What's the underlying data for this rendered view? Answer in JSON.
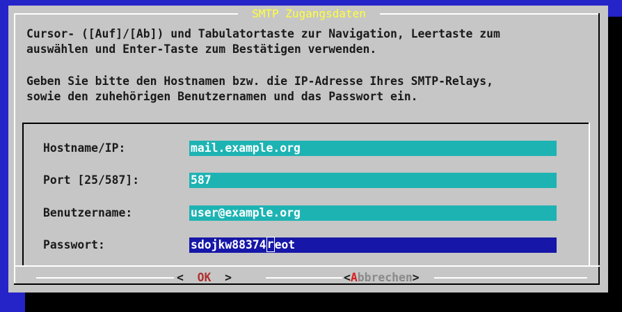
{
  "dialog": {
    "title": "SMTP Zugangsdaten",
    "instructions": [
      "Cursor- ([Auf]/[Ab]) und Tabulatortaste zur Navigation, Leertaste zum",
      "auswählen und Enter-Taste zum Bestätigen verwenden."
    ],
    "prompt": [
      "Geben Sie bitte den Hostnamen bzw. die IP-Adresse Ihres SMTP-Relays,",
      "sowie den zuhehörigen Benutzernamen und das Passwort ein."
    ]
  },
  "form": {
    "hostname": {
      "label": "Hostname/IP:",
      "value": "mail.example.org"
    },
    "port": {
      "label": "Port [25/587]:",
      "value": "587"
    },
    "username": {
      "label": "Benutzername:",
      "value": "user@example.org"
    },
    "password": {
      "label": "Passwort:",
      "value_before": "sdojkw88374",
      "value_cursor": "r",
      "value_after": "eot"
    }
  },
  "buttons": {
    "ok": {
      "left": "<",
      "label": "OK",
      "right": ">"
    },
    "cancel": {
      "left": "<",
      "hotkey": "A",
      "rest": "bbrechen",
      "right": ">"
    }
  },
  "colors": {
    "background": "#2424c8",
    "dialog": "#c6c6c6",
    "title": "#ffff3a",
    "field": "#1eb3b3",
    "field_active": "#1616a8"
  }
}
